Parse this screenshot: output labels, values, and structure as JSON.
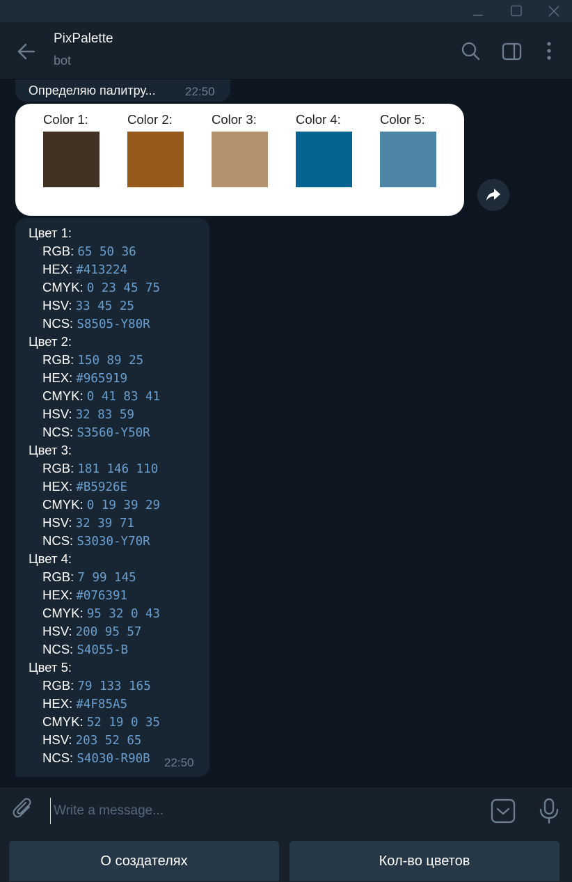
{
  "window": {
    "minimize": "minimize",
    "maximize": "maximize",
    "close": "close"
  },
  "header": {
    "title": "PixPalette",
    "subtitle": "bot",
    "icons": [
      "back-arrow-icon",
      "search-icon",
      "sidebar-toggle-icon",
      "more-vertical-icon"
    ]
  },
  "messages": {
    "status": {
      "text": "Определяю палитру...",
      "time": "22:50"
    },
    "palette_image": {
      "colors": [
        {
          "label": "Color 1:",
          "hex": "#413224"
        },
        {
          "label": "Color 2:",
          "hex": "#965919"
        },
        {
          "label": "Color 3:",
          "hex": "#B5926E"
        },
        {
          "label": "Color 4:",
          "hex": "#076391"
        },
        {
          "label": "Color 5:",
          "hex": "#4F85A5"
        }
      ]
    },
    "info": {
      "time": "22:50",
      "colors": [
        {
          "heading": "Цвет 1:",
          "rgb": "65 50 36",
          "hex": "#413224",
          "cmyk": "0 23 45 75",
          "hsv": "33 45 25",
          "ncs": "S8505-Y80R"
        },
        {
          "heading": "Цвет 2:",
          "rgb": "150 89 25",
          "hex": "#965919",
          "cmyk": "0 41 83 41",
          "hsv": "32 83 59",
          "ncs": "S3560-Y50R"
        },
        {
          "heading": "Цвет 3:",
          "rgb": "181 146 110",
          "hex": "#B5926E",
          "cmyk": "0 19 39 29",
          "hsv": "32 39 71",
          "ncs": "S3030-Y70R"
        },
        {
          "heading": "Цвет 4:",
          "rgb": "7 99 145",
          "hex": "#076391",
          "cmyk": "95 32 0 43",
          "hsv": "200 95 57",
          "ncs": "S4055-B"
        },
        {
          "heading": "Цвет 5:",
          "rgb": "79 133 165",
          "hex": "#4F85A5",
          "cmyk": "52 19 0 35",
          "hsv": "203 52 65",
          "ncs": "S4030-R90B"
        }
      ]
    }
  },
  "labels": {
    "rgb": "RGB:",
    "hex": "HEX:",
    "cmyk": "CMYK:",
    "hsv": "HSV:",
    "ncs": "NCS:"
  },
  "composer": {
    "placeholder": "Write a message...",
    "value": ""
  },
  "keyboard": {
    "buttons": [
      "О создателях",
      "Кол-во цветов"
    ]
  },
  "theme": {
    "background": "#0e1621",
    "header": "#17212b",
    "bubble": "#182533",
    "accent_value": "#6a9fcf",
    "keyboard_button": "#263747"
  }
}
